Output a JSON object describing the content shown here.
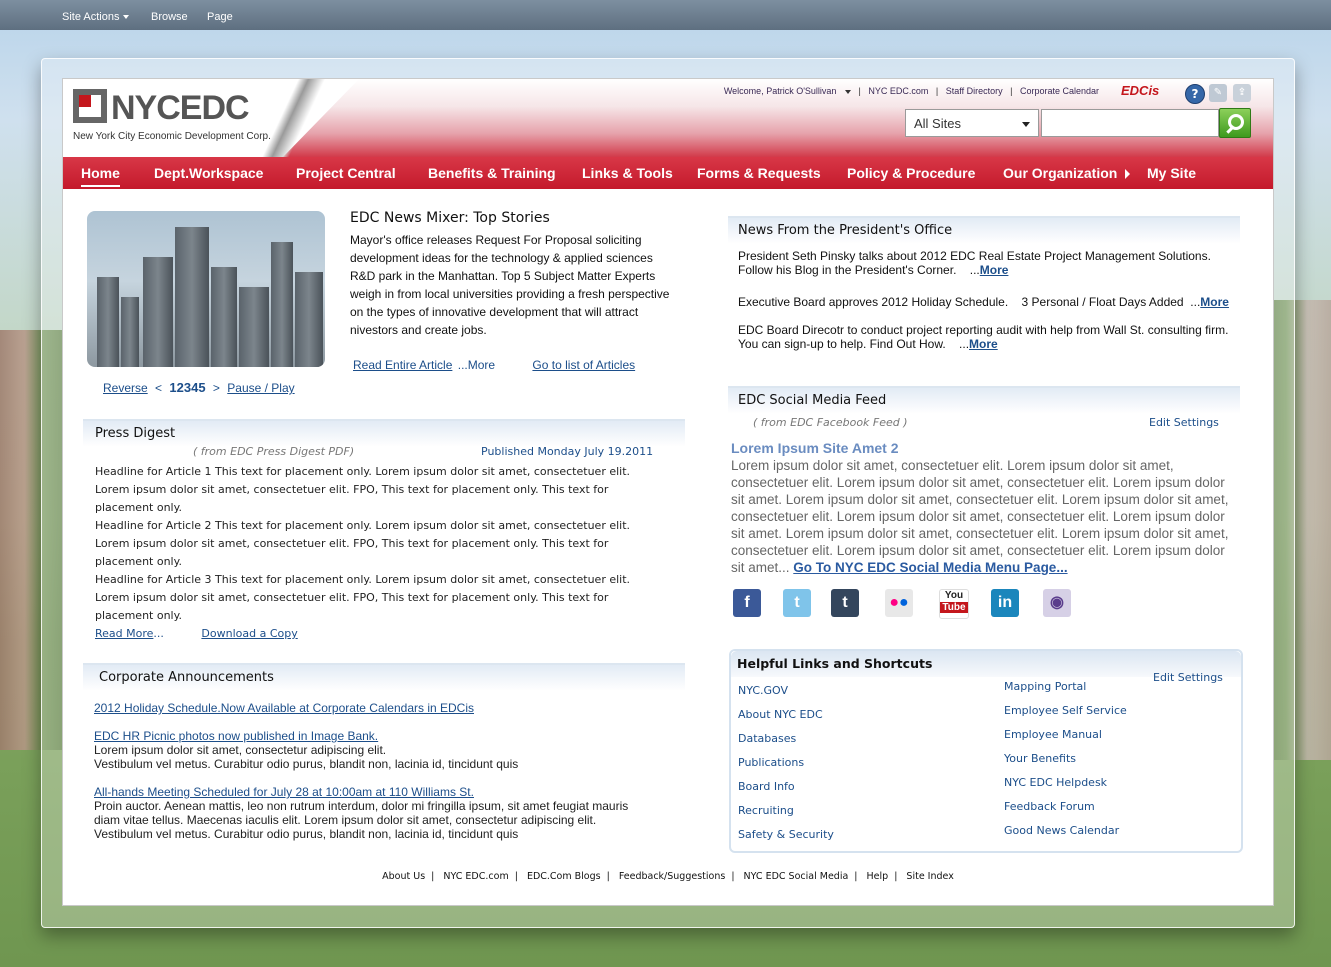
{
  "topbar": {
    "site_actions": "Site Actions",
    "browse": "Browse",
    "page": "Page"
  },
  "header": {
    "logo_text": "NYCEDC",
    "logo_sub": "New York City Economic Development Corp.",
    "welcome": "Welcome, Patrick O'Sullivan",
    "links": [
      "NYC EDC.com",
      "Staff Directory",
      "Corporate Calendar"
    ],
    "edcis": "EDCis",
    "search_scope": "All Sites",
    "search_value": ""
  },
  "nav": [
    "Home",
    "Dept.Workspace",
    "Project Central",
    "Benefits & Training",
    "Links & Tools",
    "Forms & Requests",
    "Policy & Procedure",
    "Our Organization",
    "My Site"
  ],
  "news": {
    "title": "EDC News Mixer: Top Stories",
    "body": "Mayor's office releases Request For Proposal soliciting development ideas for the technology & applied sciences R&D park in the Manhattan. Top 5 Subject Matter Experts weigh in from local universities providing a fresh perspective on the types of innovative development that will attract nivestors and create jobs.",
    "read_entire": "Read Entire Article",
    "more": "...More",
    "go_list": "Go to list of Articles",
    "reverse": "Reverse",
    "pages": [
      "1",
      "2",
      "3",
      "4",
      "5"
    ],
    "pause_play": "Pause / Play"
  },
  "press": {
    "title": "Press Digest",
    "source": "( from EDC Press Digest PDF)",
    "published": "Published Monday July 19.2011",
    "lines": [
      "Headline for Article 1 This text for placement only. Lorem ipsum dolor sit amet, consectetuer elit.",
      "Lorem ipsum dolor sit amet, consectetuer elit. FPO, This text for placement only. This text for",
      "placement only.",
      "Headline for Article 2 This text for placement only. Lorem ipsum dolor sit amet, consectetuer elit.",
      "Lorem ipsum dolor sit amet, consectetuer elit. FPO, This text for placement only. This text for",
      "placement only.",
      "Headline for Article 3 This text for placement only. Lorem ipsum dolor sit amet, consectetuer elit.",
      "Lorem ipsum dolor sit amet, consectetuer elit. FPO, This text for placement only. This text for",
      "placement only."
    ],
    "read_more": "Read More",
    "read_more_suffix": "...",
    "download": "Download a Copy"
  },
  "announcements": {
    "title": "Corporate Announcements",
    "items": [
      {
        "link": "2012 Holiday Schedule.Now Available at Corporate Calendars in EDCis",
        "lines": []
      },
      {
        "link": "EDC HR Picnic photos now published in Image Bank.",
        "lines": [
          "Lorem ipsum dolor sit amet, consectetur adipiscing elit.",
          "Vestibulum vel metus. Curabitur odio purus, blandit non, lacinia id, tincidunt quis"
        ]
      },
      {
        "link": "All-hands Meeting Scheduled for July 28 at 10:00am at 110 Williams St.",
        "lines": [
          "Proin auctor. Aenean mattis, leo non rutrum interdum, dolor mi fringilla ipsum, sit amet feugiat mauris",
          "diam vitae tellus. Maecenas iaculis elit.  Lorem ipsum dolor sit amet, consectetur adipiscing elit.",
          "Vestibulum vel metus. Curabitur odio purus, blandit non, lacinia id, tincidunt quis"
        ]
      }
    ]
  },
  "president": {
    "title": "News From the President's Office",
    "items": [
      {
        "l1": "President Seth Pinsky talks about 2012 EDC Real Estate Project Management Solutions.",
        "l2": "Follow his Blog in the President's Corner.",
        "more": "More"
      },
      {
        "l1": "Executive Board approves 2012 Holiday Schedule.    3 Personal / Float Days Added",
        "l2": "",
        "more": "More"
      },
      {
        "l1": "EDC Board Direcotr to conduct project reporting audit with help from Wall St. consulting firm.",
        "l2": "You can sign-up to help.  Find Out How.",
        "more": "More"
      }
    ]
  },
  "social": {
    "title": "EDC Social Media Feed",
    "source": "( from EDC Facebook Feed )",
    "edit": "Edit Settings",
    "post_title": "Lorem Ipsum Site Amet 2",
    "post_lines": [
      "Lorem ipsum dolor sit amet, consectetuer elit. Lorem ipsum dolor sit amet,",
      "consectetuer elit. Lorem ipsum dolor sit amet, consectetuer elit. Lorem ipsum dolor",
      "sit amet.  Lorem ipsum dolor sit amet, consectetuer elit. Lorem ipsum dolor sit amet,",
      "consectetuer elit. Lorem ipsum dolor sit amet, consectetuer elit. Lorem ipsum dolor",
      "sit amet. Lorem ipsum dolor sit amet, consectetuer elit. Lorem ipsum dolor sit amet,",
      "consectetuer elit. Lorem ipsum dolor sit amet, consectetuer elit. Lorem ipsum dolor",
      "sit amet... "
    ],
    "go_link": "Go To NYC EDC Social Media Menu Page...",
    "icons": [
      "facebook-icon",
      "twitter-icon",
      "tumblr-icon",
      "flickr-icon",
      "youtube-icon",
      "linkedin-icon",
      "podcast-icon"
    ]
  },
  "helpful": {
    "title": "Helpful Links and Shortcuts",
    "edit": "Edit Settings",
    "left": [
      "NYC.GOV",
      "About NYC EDC",
      "Databases",
      "Publications",
      "Board Info",
      "Recruiting",
      "Safety & Security"
    ],
    "right": [
      "Mapping Portal",
      "Employee Self Service",
      "Employee Manual",
      "Your Benefits",
      "NYC EDC Helpdesk",
      "Feedback Forum",
      "Good News Calendar"
    ]
  },
  "footer": [
    "About Us",
    "NYC EDC.com",
    "EDC.Com Blogs",
    "Feedback/Suggestions",
    "NYC EDC Social Media",
    "Help",
    "Site Index"
  ]
}
